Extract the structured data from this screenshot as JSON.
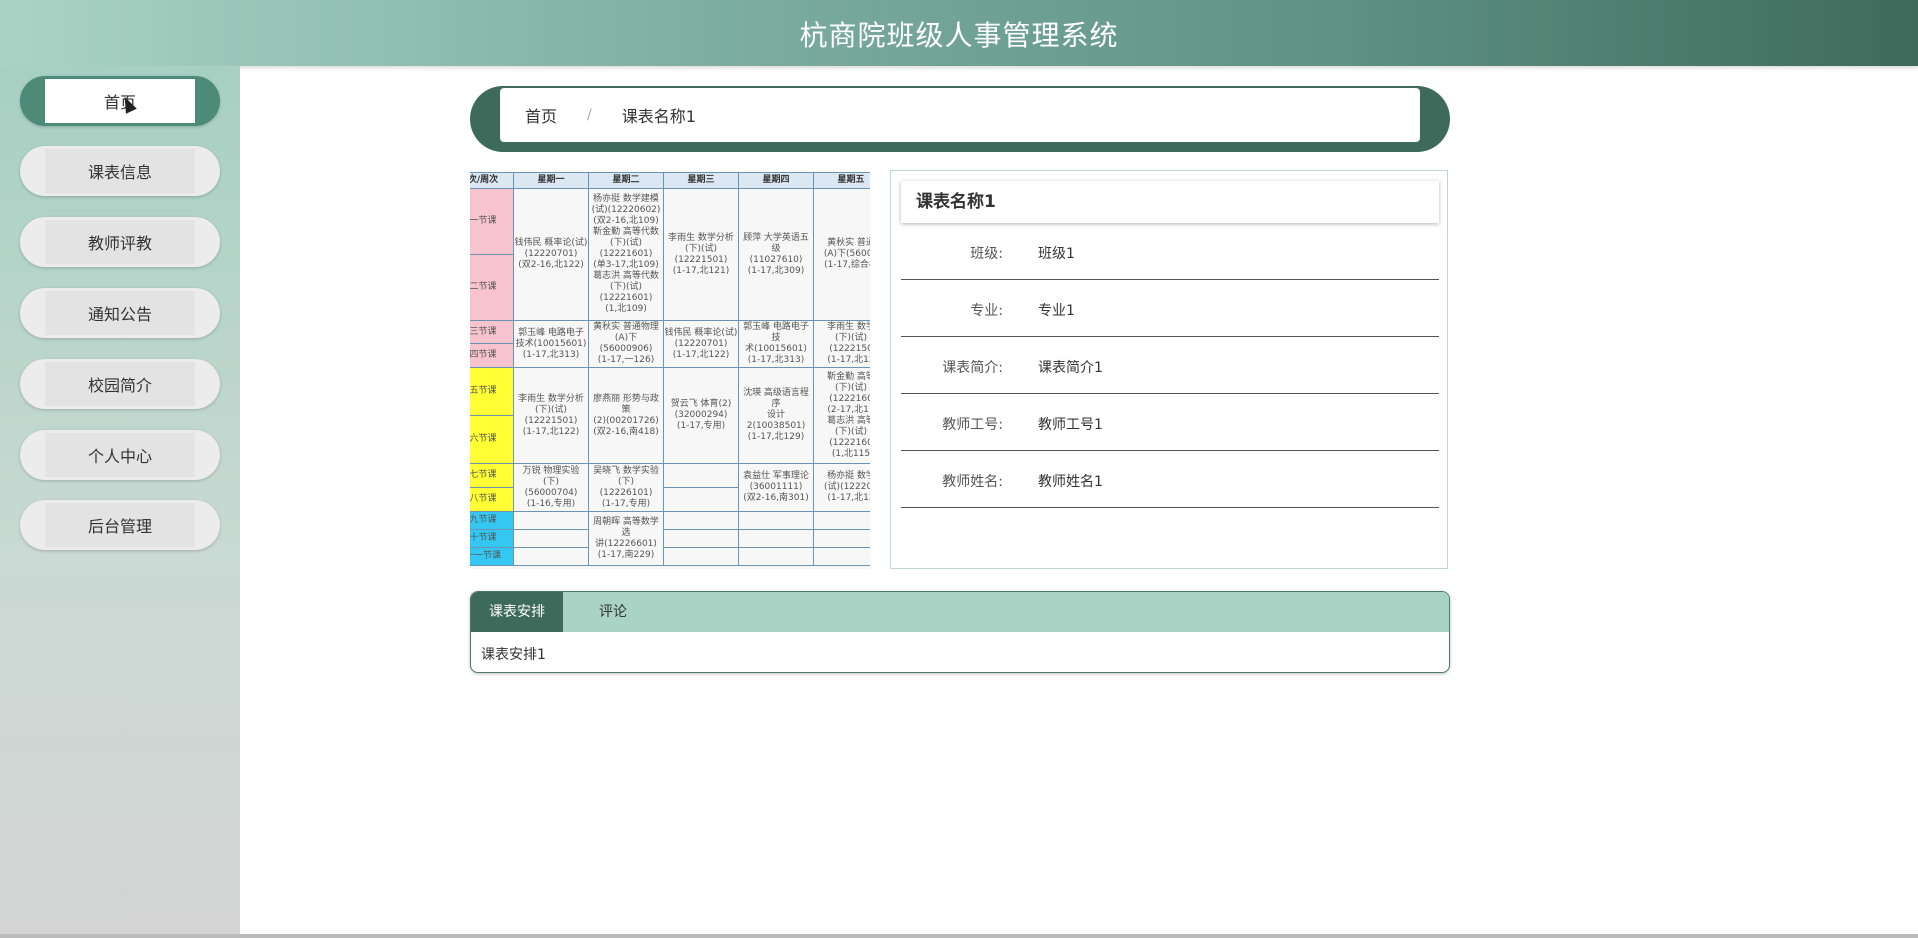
{
  "app": {
    "title": "杭商院班级人事管理系统"
  },
  "sidebar": {
    "items": [
      {
        "label": "首页",
        "active": true
      },
      {
        "label": "课表信息"
      },
      {
        "label": "教师评教"
      },
      {
        "label": "通知公告"
      },
      {
        "label": "校园简介"
      },
      {
        "label": "个人中心"
      },
      {
        "label": "后台管理"
      }
    ]
  },
  "breadcrumb": {
    "home": "首页",
    "separator": "/",
    "current": "课表名称1"
  },
  "schedule_image": {
    "headers": [
      "次/周次",
      "星期一",
      "星期二",
      "星期三",
      "星期四",
      "星期五"
    ],
    "periods": [
      {
        "label": "一节课",
        "color": "#f7c3cd"
      },
      {
        "label": "二节课",
        "color": "#f7c3cd"
      },
      {
        "label": "三节课",
        "color": "#f7c3cd"
      },
      {
        "label": "四节课",
        "color": "#f7c3cd"
      },
      {
        "label": "五节课",
        "color": "#ffff33"
      },
      {
        "label": "六节课",
        "color": "#ffff33"
      },
      {
        "label": "七节课",
        "color": "#ffff33"
      },
      {
        "label": "八节课",
        "color": "#ffff33"
      },
      {
        "label": "九节课",
        "color": "#33c7f2"
      },
      {
        "label": "十节课",
        "color": "#33c7f2"
      },
      {
        "label": "十一节课",
        "color": "#33c7f2"
      }
    ],
    "cells": {
      "mon_1": "钱伟民 概率论(试)\n(12220701)\n(双2-16,北122)",
      "tue_1": "杨亦挺 数学建模\n(试)(12220602)\n(双2-16,北109)\n靳金勤 高等代数\n(下)(试)\n(12221601)\n(单3-17,北109)\n葛志洪 高等代数\n(下)(试)\n(12221601)\n(1,北109)",
      "wed_1": "李雨生 数学分析\n(下)(试)\n(12221501)\n(1-17,北121)",
      "thu_1": "顾萍 大学英语五级\n(11027610)\n(1-17,北309)",
      "fri_1": "黄秋实 普通\n(A)下(56000\n(1-17,综合楼",
      "mon_3": "郭玉峰 电路电子\n技术(10015601)\n(1-17,北313)",
      "tue_3": "黄秋实 普通物理\n(A)下(56000906)\n(1-17,一126)",
      "wed_3": "钱伟民 概率论(试)\n(12220701)\n(1-17,北122)",
      "thu_3": "郭玉峰 电路电子技\n术(10015601)\n(1-17,北313)",
      "fri_3": "李雨生 数学\n(下)(试)\n(1222150\n(1-17,北12",
      "mon_5": "李雨生 数学分析\n(下)(试)\n(12221501)\n(1-17,北122)",
      "tue_5": "廖燕丽 形势与政策\n(2)(00201726)\n(双2-16,南418)",
      "wed_5": "贺云飞 体育(2)\n(32000294)\n(1-17,专用)",
      "thu_5": "沈瑛 高级语言程序\n设计2(10038501)\n(1-17,北129)",
      "fri_5": "靳金勤 高等\n(下)(试)\n(1222160\n(2-17,北11\n葛志洪 高等\n(下)(试)\n(1222160\n(1,北115",
      "mon_7": "万锐 物理实验\n(下)\n(56000704)\n(1-16,专用)",
      "tue_7": "吴晓飞 数学实验\n(下)\n(12226101)\n(1-17,专用)",
      "thu_7": "袁益仕 军事理论\n(36001111)\n(双2-16,南301)",
      "fri_7": "杨亦挺 数学\n(试)(122206\n(1-17,北12",
      "tue_9": "周朝晖 高等数学选\n讲(12226601)\n(1-17,南229)"
    }
  },
  "detail": {
    "title": "课表名称1",
    "rows": [
      {
        "label": "班级:",
        "value": "班级1"
      },
      {
        "label": "专业:",
        "value": "专业1"
      },
      {
        "label": "课表简介:",
        "value": "课表简介1"
      },
      {
        "label": "教师工号:",
        "value": "教师工号1"
      },
      {
        "label": "教师姓名:",
        "value": "教师姓名1"
      }
    ]
  },
  "tabs": {
    "items": [
      {
        "label": "课表安排"
      },
      {
        "label": "评论"
      }
    ],
    "content": "课表安排1"
  }
}
